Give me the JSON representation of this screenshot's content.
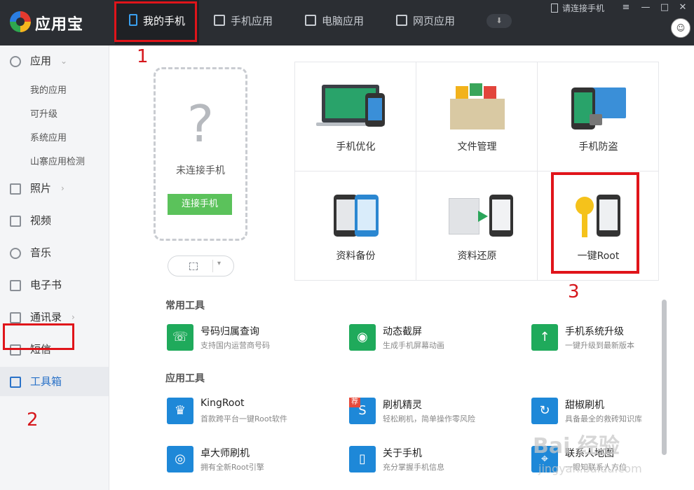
{
  "app": {
    "name": "应用宝"
  },
  "header": {
    "tabs": [
      {
        "label": "我的手机"
      },
      {
        "label": "手机应用"
      },
      {
        "label": "电脑应用"
      },
      {
        "label": "网页应用"
      }
    ],
    "connect_status": "请连接手机",
    "avatar": "☺"
  },
  "sidebar": {
    "apps_label": "应用",
    "app_sub": [
      "我的应用",
      "可升级",
      "系统应用",
      "山寨应用检测"
    ],
    "photos": "照片",
    "video": "视频",
    "music": "音乐",
    "ebook": "电子书",
    "contacts": "通讯录",
    "sms": "短信",
    "toolbox": "工具箱"
  },
  "phone_panel": {
    "placeholder": "?",
    "status": "未连接手机",
    "connect_label": "连接手机"
  },
  "tiles": [
    {
      "label": "手机优化"
    },
    {
      "label": "文件管理"
    },
    {
      "label": "手机防盗"
    },
    {
      "label": "资料备份"
    },
    {
      "label": "资料还原"
    },
    {
      "label": "一键Root"
    }
  ],
  "sections": {
    "common": "常用工具",
    "app_tools": "应用工具"
  },
  "common_tools": [
    {
      "name": "号码归属查询",
      "desc": "支持国内运营商号码"
    },
    {
      "name": "动态截屏",
      "desc": "生成手机屏幕动画"
    },
    {
      "name": "手机系统升级",
      "desc": "一键升级到最新版本"
    }
  ],
  "app_tools": [
    {
      "name": "KingRoot",
      "desc": "首款跨平台一键Root软件"
    },
    {
      "name": "刷机精灵",
      "desc": "轻松刷机，简单操作零风险",
      "badge": "荐"
    },
    {
      "name": "甜椒刷机",
      "desc": "具备最全的救砖知识库"
    },
    {
      "name": "卓大师刷机",
      "desc": "拥有全新Root引擎"
    },
    {
      "name": "关于手机",
      "desc": "充分掌握手机信息"
    },
    {
      "name": "联系人地图",
      "desc": "一眼知联系人方位"
    }
  ],
  "annotations": [
    "1",
    "2",
    "3"
  ],
  "watermark": {
    "main": "Bai 经验",
    "sub": "jingyan.baidu.com"
  },
  "colors": {
    "accent_green": "#5bc25b",
    "header_bg": "#2b2e33",
    "highlight_red": "#e0141a",
    "selected_blue": "#2a72c8"
  }
}
